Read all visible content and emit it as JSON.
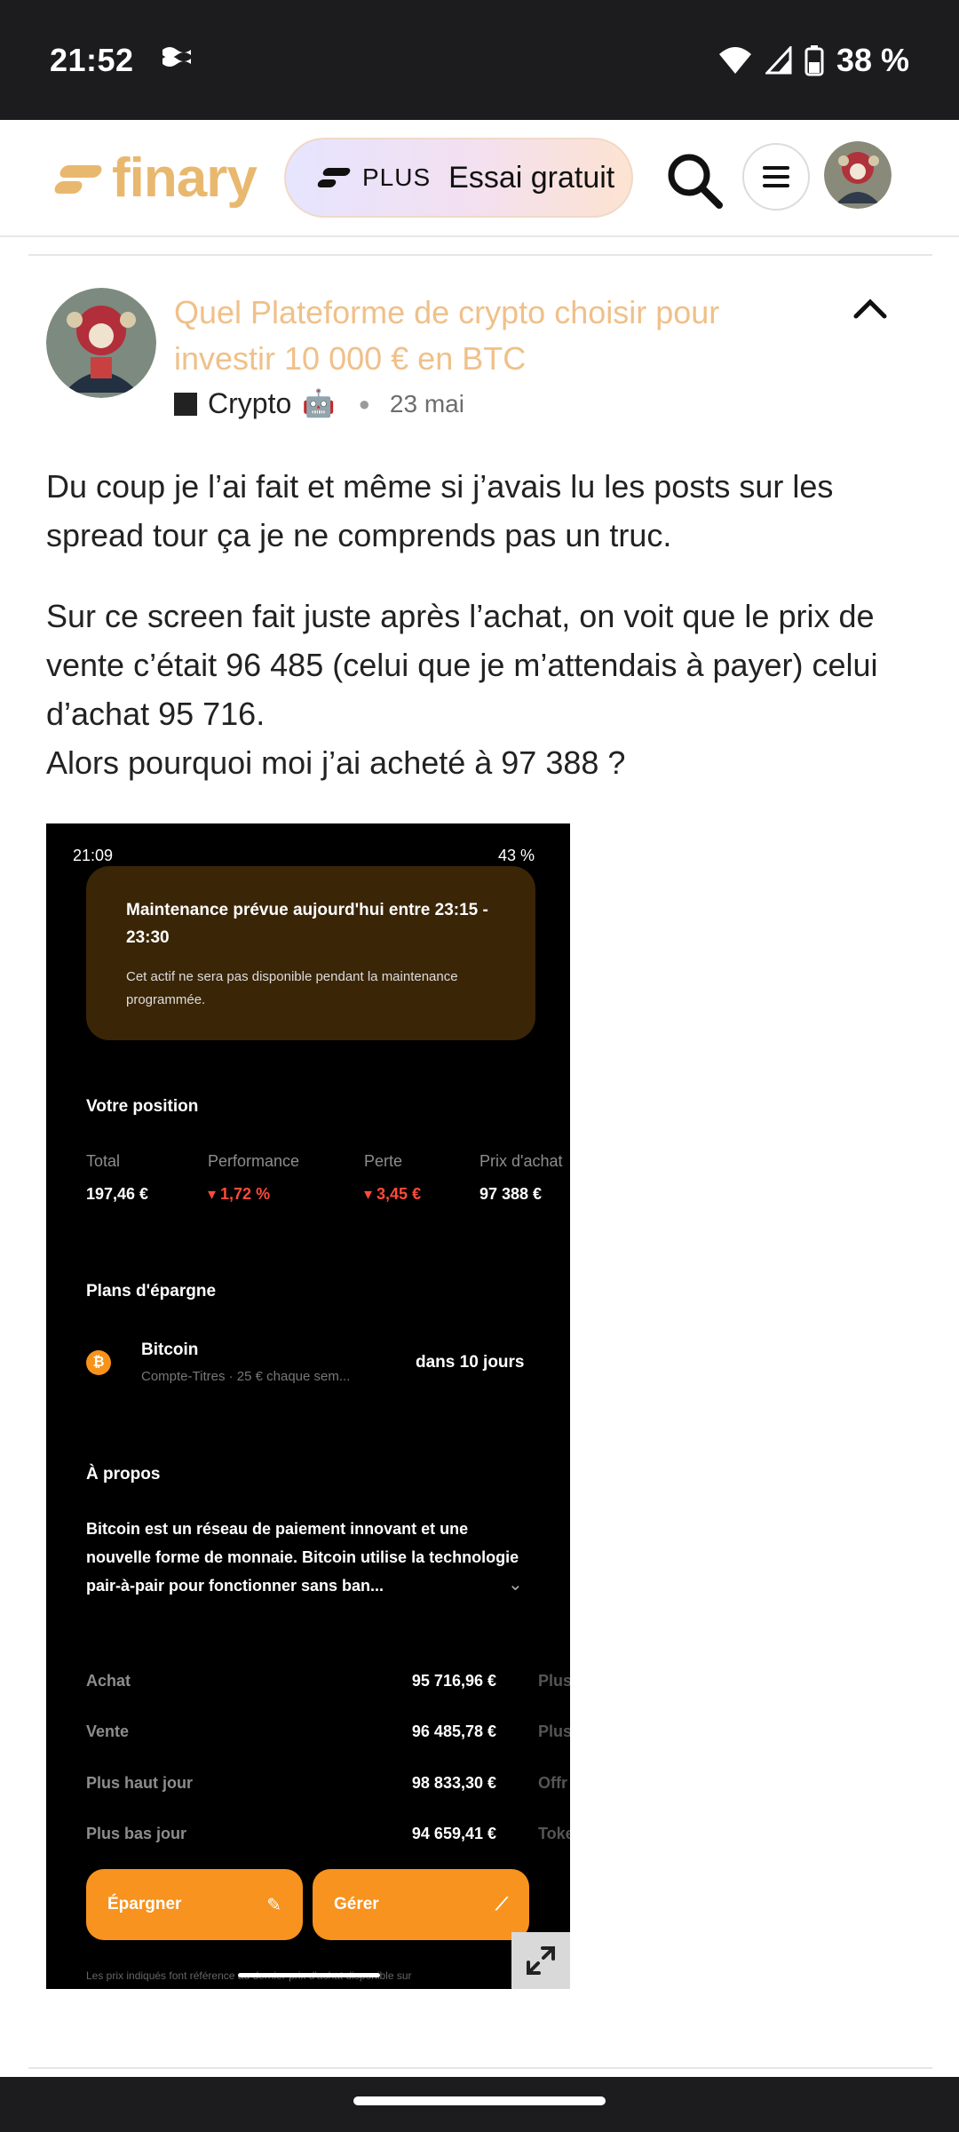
{
  "status_bar": {
    "time": "21:52",
    "battery": "38 %"
  },
  "header": {
    "logo_text": "finary",
    "plus_label": "PLUS",
    "trial_label": "Essai gratuit"
  },
  "post": {
    "title": "Quel Plateforme de crypto choisir pour investir 10 000 € en BTC",
    "category": "Crypto",
    "category_emoji": "🤖",
    "date": "23 mai",
    "paragraphs": [
      "Du coup je l’ai fait et même si j’avais lu les posts sur les spread tour ça je ne comprends pas un truc.",
      "Sur ce screen fait juste après l’achat, on voit que le prix de vente c’était 96 485 (celui que je m’attendais à payer) celui d’achat 95 716.",
      "Alors pourquoi moi j’ai acheté à 97 388 ?"
    ]
  },
  "embedded": {
    "status_time": "21:09",
    "status_battery": "43 %",
    "maintenance_title": "Maintenance prévue aujourd'hui entre 23:15 - 23:30",
    "maintenance_desc": "Cet actif ne sera pas disponible pendant la maintenance programmée.",
    "position_title": "Votre position",
    "position_cols": [
      {
        "label": "Total",
        "value": "197,46 €"
      },
      {
        "label": "Performance",
        "value": "▾ 1,72 %"
      },
      {
        "label": "Perte",
        "value": "▾ 3,45 €"
      },
      {
        "label": "Prix d'achat",
        "value": "97 388 €"
      }
    ],
    "savings_title": "Plans d'épargne",
    "savings_asset": "Bitcoin",
    "savings_sub": "Compte-Titres · 25 € chaque sem...",
    "savings_when": "dans 10 jours",
    "about_title": "À propos",
    "about_text": "Bitcoin est un réseau de paiement innovant et une nouvelle forme de monnaie. Bitcoin utilise la technologie pair-à-pair pour fonctionner sans ban...",
    "rows": [
      {
        "label": "Achat",
        "value": "95 716,96 €",
        "extra": "Plus"
      },
      {
        "label": "Vente",
        "value": "96 485,78 €",
        "extra": "Plus"
      },
      {
        "label": "Plus haut jour",
        "value": "98 833,30 €",
        "extra": "Offr"
      },
      {
        "label": "Plus bas jour",
        "value": "94 659,41 €",
        "extra": "Toke"
      }
    ],
    "save_button": "Épargner",
    "manage_button": "Gérer",
    "footnote": "Les prix indiqués font référence au dernier prix d'achat disponible sur"
  },
  "colors": {
    "brand": "#e9b86f",
    "title": "#f0c089",
    "accent_orange": "#f7931e",
    "negative": "#ff4b3a"
  }
}
